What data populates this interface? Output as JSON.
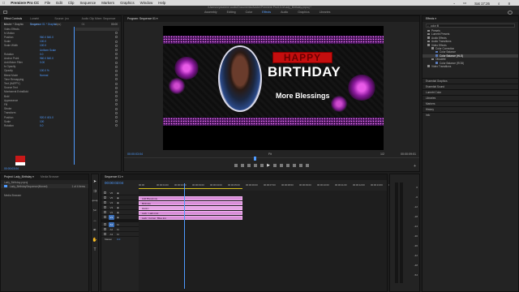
{
  "menubar": {
    "app": "Premiere Pro CC",
    "items": [
      "File",
      "Edit",
      "Clip",
      "Sequence",
      "Markers",
      "Graphics",
      "Window",
      "Help"
    ],
    "clock": "Sat 17:26"
  },
  "path": "/Users/crystalvine.audio/Documents/Adobe/Premiere Pro/13.0/Lady_Birthday.prproj *",
  "workspaces": [
    "Assembly",
    "Editing",
    "Color",
    "Effects",
    "Audio",
    "Graphics",
    "Libraries"
  ],
  "active_workspace": "Effects",
  "effect_controls": {
    "tabs": [
      "Effect Controls ≡",
      "Lumetri Scopes",
      "Source: (no clips)",
      "Audio Clip Mixer: Sequence 01"
    ],
    "master_label": "Master * Graphic",
    "sequence_label": "Sequence 01 * Graphic",
    "ruler_time": "00:00",
    "ruler_end": "00:00",
    "rows": [
      {
        "label": "Video Effects",
        "blue": false
      },
      {
        "label": "fx  Motion",
        "blue": false
      },
      {
        "label": "Position",
        "value": "960.0   540.0"
      },
      {
        "label": "Scale",
        "value": "100.0"
      },
      {
        "label": "Scale Width",
        "value": "100.0"
      },
      {
        "label": "",
        "value": "Uniform Scale"
      },
      {
        "label": "Rotation",
        "value": "0.0"
      },
      {
        "label": "Anchor Point",
        "value": "960.0   540.0"
      },
      {
        "label": "Anti-flicker Filter",
        "value": "0.00"
      },
      {
        "label": "fx  Opacity",
        "value": ""
      },
      {
        "label": "Opacity",
        "value": "100.0 %"
      },
      {
        "label": "Blend Mode",
        "value": "Normal"
      },
      {
        "label": "Time Remapping",
        "value": ""
      },
      {
        "label": "Text (HAPPY)",
        "value": ""
      },
      {
        "label": "Source Text",
        "value": ""
      },
      {
        "label": "Montserrat ExtraBold",
        "value": ""
      },
      {
        "label": "Bold",
        "value": ""
      },
      {
        "label": "Appearance",
        "value": ""
      },
      {
        "label": "Fill",
        "value": ""
      },
      {
        "label": "Stroke",
        "value": ""
      },
      {
        "label": "Transform",
        "value": ""
      },
      {
        "label": "Position",
        "value": "920.0   401.0"
      },
      {
        "label": "Scale",
        "value": "100"
      },
      {
        "label": "Rotation",
        "value": "0.0"
      }
    ],
    "timecode": "00:00:03:04"
  },
  "project": {
    "tabs": [
      "Project: Lady_Birthday ≡",
      "Media Browser"
    ],
    "file": "Lady_Birthday.prproj",
    "bin": "Lady_BirthdaySequence(Moved)",
    "count": "1 of 4 items",
    "media_label": "Media Browser"
  },
  "program": {
    "tab": "Program: Sequence 01 ≡",
    "timecode": "00:00:03:04",
    "fit": "Fit",
    "ratio": "1/2",
    "duration": "00:00:09:01",
    "card": {
      "happy": "HAPPY",
      "birthday": "BIRTHDAY",
      "blessings": "More Blessings"
    }
  },
  "effects": {
    "tab": "Effects ≡",
    "search": "color fil",
    "tree": [
      {
        "label": "Presets",
        "depth": 0
      },
      {
        "label": "Lumetri Presets",
        "depth": 0
      },
      {
        "label": "Audio Effects",
        "depth": 0
      },
      {
        "label": "Audio Transitions",
        "depth": 0
      },
      {
        "label": "Video Effects",
        "depth": 0
      },
      {
        "label": "Color Correction",
        "depth": 1
      },
      {
        "label": "Color Balance",
        "depth": 2
      },
      {
        "label": "Color Balance (HLS)",
        "depth": 2,
        "selected": true
      },
      {
        "label": "Obsolete",
        "depth": 1
      },
      {
        "label": "Color Balance (RGB)",
        "depth": 2
      },
      {
        "label": "Video Transitions",
        "depth": 0
      }
    ],
    "panels": [
      "Essential Graphics",
      "Essential Sound",
      "Lumetri Color",
      "Libraries",
      "Markers",
      "History",
      "Info"
    ]
  },
  "timeline": {
    "tab": "Sequence 01 ≡",
    "timecode": "00:00:03:04",
    "ruler": [
      "00:00",
      "00:00:01:00",
      "00:00:02:00",
      "00:00:03:00",
      "00:00:04:00",
      "00:00:05:00",
      "00:00:06:00",
      "00:00:07:00",
      "00:00:08:00",
      "00:00:09:00",
      "00:00:10:00",
      "00:00:11:00",
      "00:00:12:00",
      "00:00:13:00",
      "00:00:14:00"
    ],
    "video_tracks": [
      "V6",
      "V5",
      "V4",
      "V3",
      "V2",
      "V1"
    ],
    "audio_tracks": [
      "A1",
      "A2",
      "A3"
    ],
    "master": "Master",
    "master_val": "0.0",
    "clips": [
      "Add Blessings",
      "Birthday",
      "Happy",
      "Lady_Lady.png",
      "Lady_Corner_Blue.jpg"
    ]
  },
  "meter_labels": [
    "0",
    "-6",
    "-12",
    "-18",
    "-24",
    "-30",
    "-36",
    "-42",
    "-48",
    "-54"
  ]
}
